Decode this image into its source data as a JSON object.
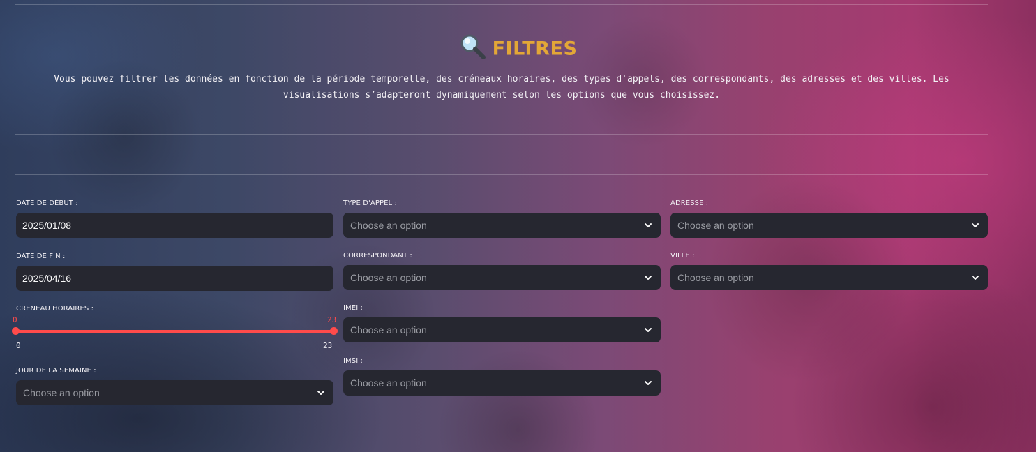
{
  "header": {
    "icon": "magnifier-icon",
    "title": "FILTRES",
    "description": "Vous pouvez filtrer les données en fonction de la période temporelle, des créneaux horaires, des types d'appels, des correspondants, des adresses et des villes. Les visualisations s’adapteront dynamiquement selon les options que vous choisissez."
  },
  "colors": {
    "title": "#e3a737",
    "accent": "#ff4b4b",
    "input_bg": "#262730"
  },
  "filters": {
    "date_debut": {
      "label": "DATE DE DÉBUT :",
      "value": "2025/01/08"
    },
    "date_fin": {
      "label": "DATE DE FIN :",
      "value": "2025/04/16"
    },
    "creneau": {
      "label": "CRENEAU HORAIRES :",
      "min": "0",
      "max": "23",
      "selected_low": "0",
      "selected_high": "23"
    },
    "jour_semaine": {
      "label": "JOUR DE LA SEMAINE :",
      "placeholder": "Choose an option"
    },
    "type_appel": {
      "label": "TYPE D'APPEL :",
      "placeholder": "Choose an option"
    },
    "correspondant": {
      "label": "CORRESPONDANT :",
      "placeholder": "Choose an option"
    },
    "imei": {
      "label": "IMEI :",
      "placeholder": "Choose an option"
    },
    "imsi": {
      "label": "IMSI :",
      "placeholder": "Choose an option"
    },
    "adresse": {
      "label": "ADRESSE :",
      "placeholder": "Choose an option"
    },
    "ville": {
      "label": "VILLE :",
      "placeholder": "Choose an option"
    }
  }
}
